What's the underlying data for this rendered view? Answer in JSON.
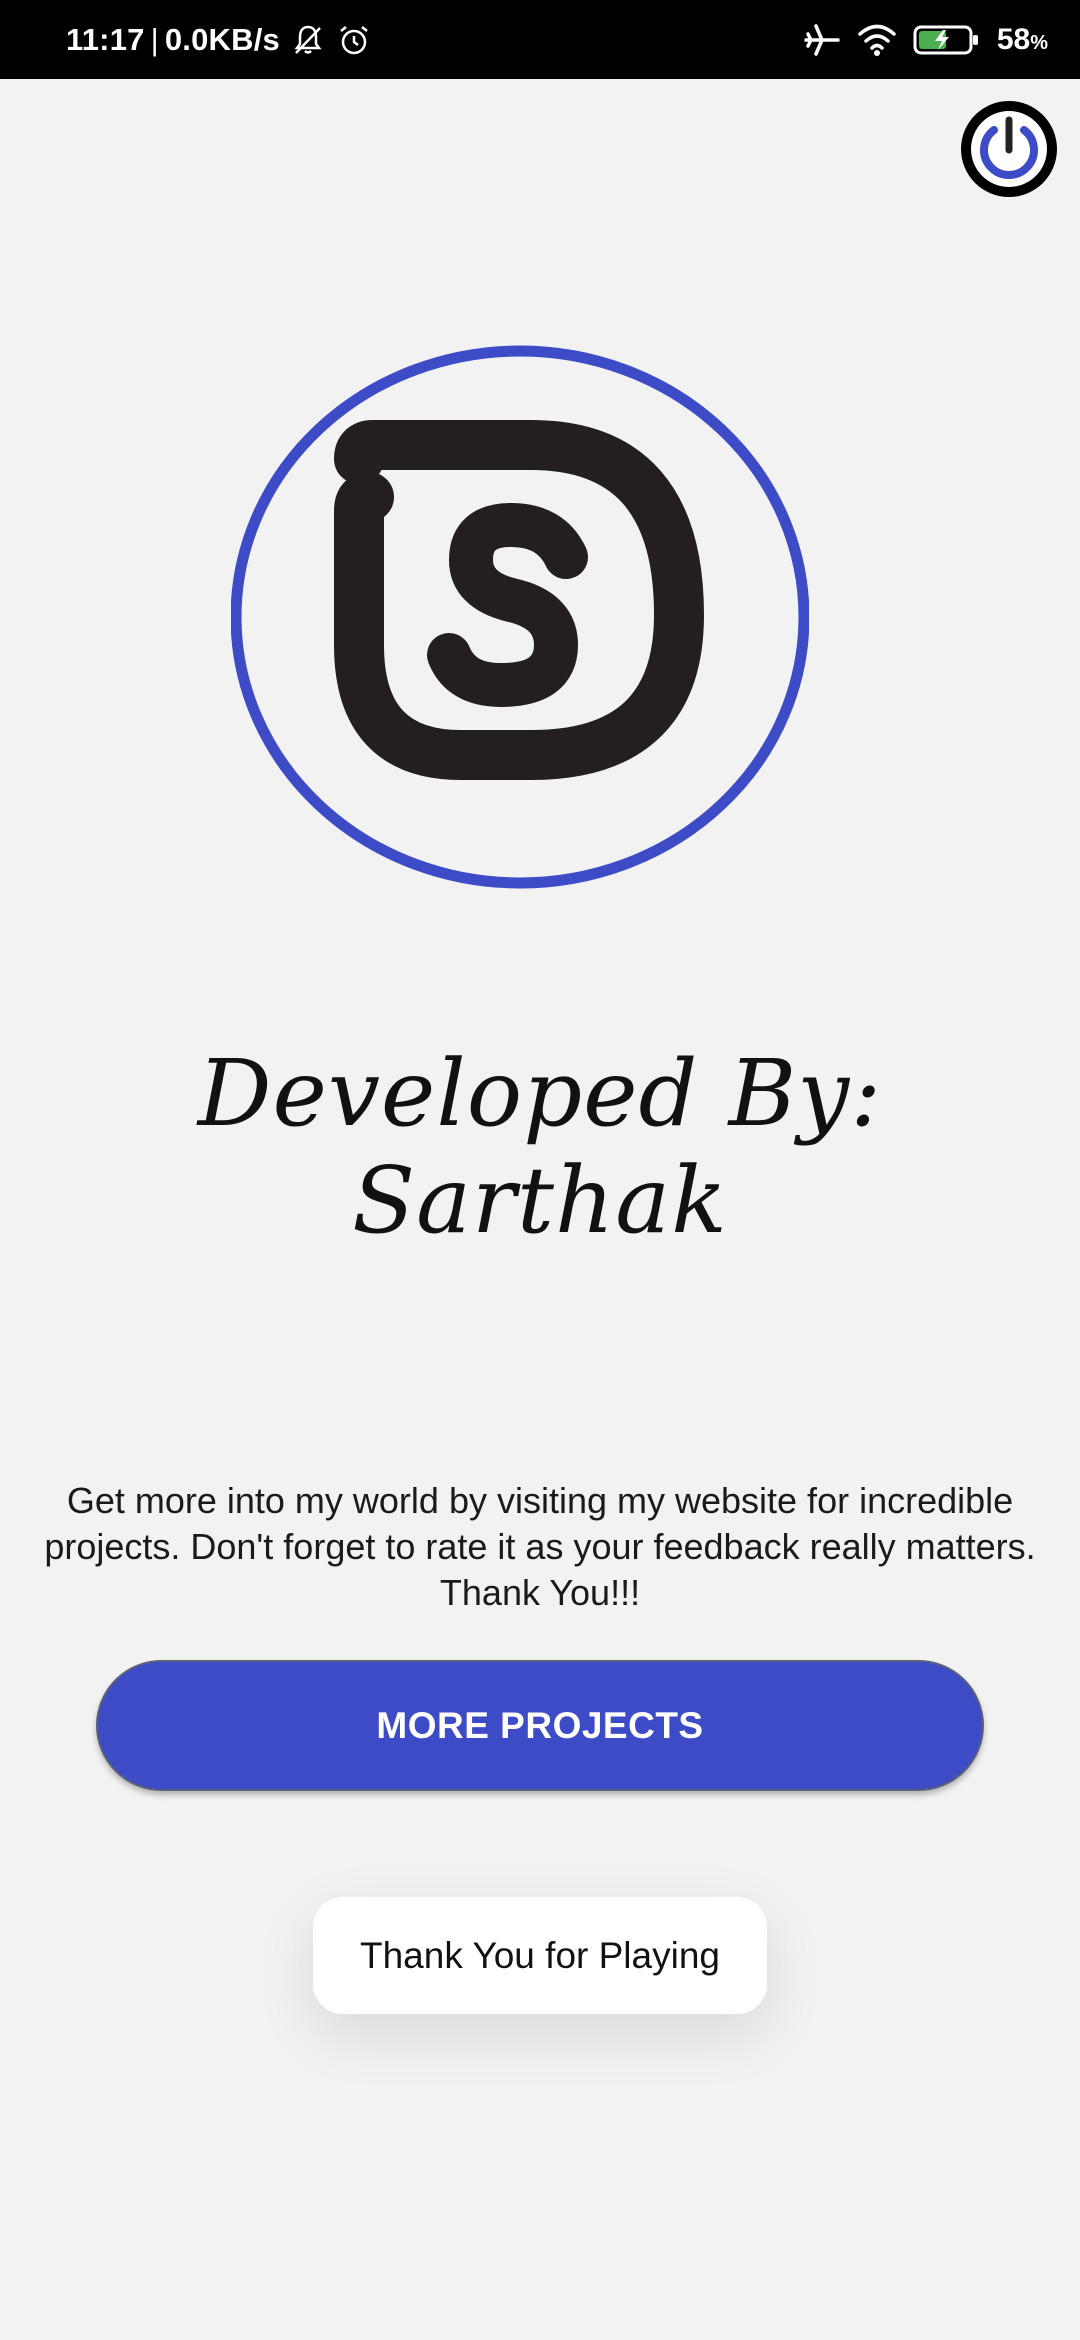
{
  "status_bar": {
    "time": "11:17",
    "separator": "|",
    "network_speed": "0.0KB/s",
    "battery_percent": "58",
    "battery_unit": "%",
    "icons": [
      "mute-icon",
      "alarm-icon",
      "airplane-icon",
      "wifi-icon",
      "battery-charging-icon"
    ]
  },
  "header": {
    "power_icon": "power-icon"
  },
  "logo": {
    "name": "ds-logo",
    "ring_color": "#3d4bc7",
    "mark_color": "#231f20"
  },
  "main": {
    "developer_title": "Developed By: Sarthak",
    "description_lines": [
      "Get more into my world by visiting my website for incredible",
      "projects. Don't forget to rate it as your feedback really matters.",
      "Thank You!!!"
    ],
    "more_projects_label": "MORE PROJECTS"
  },
  "toast": {
    "message": "Thank You for Playing"
  },
  "colors": {
    "accent": "#3d4bc7",
    "background": "#f2f2f2"
  }
}
